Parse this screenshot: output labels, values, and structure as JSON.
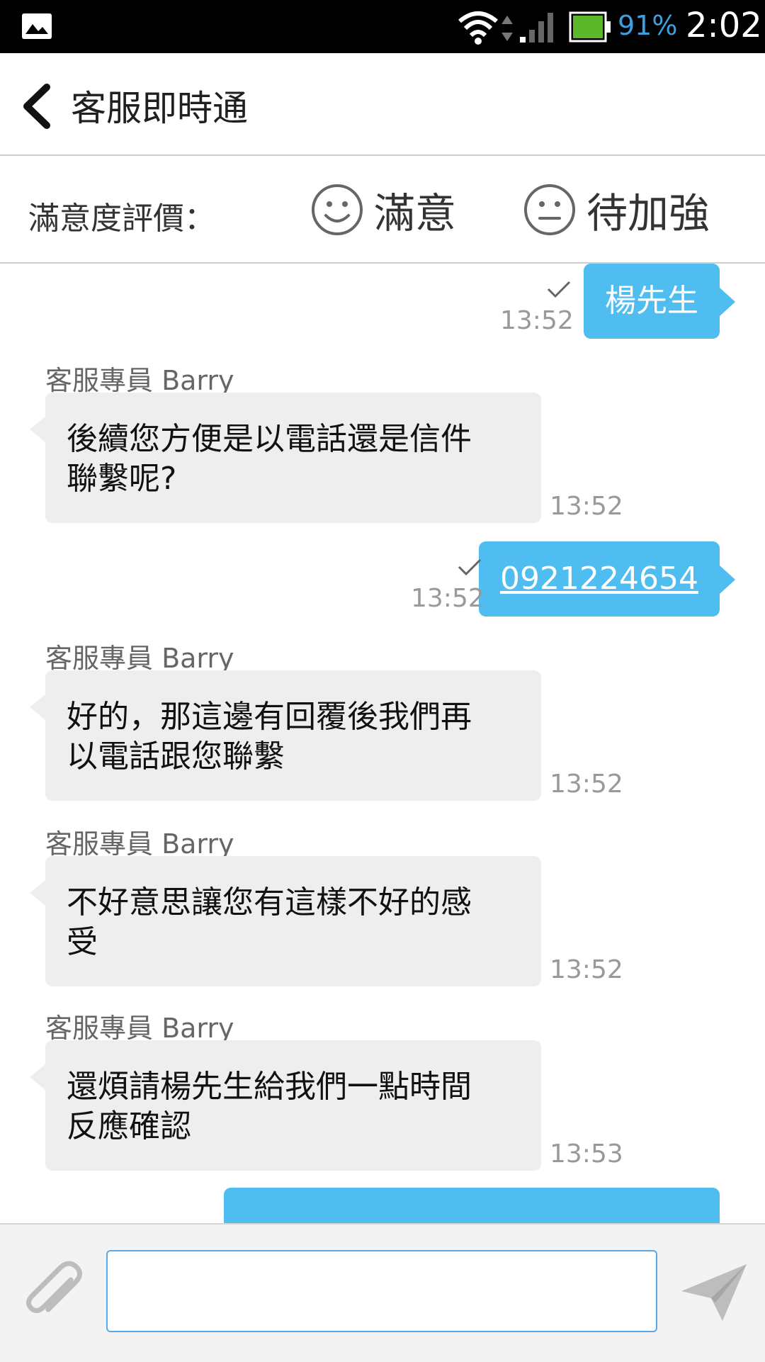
{
  "status_bar": {
    "battery_percent": "91%",
    "time": "2:02",
    "icons": [
      "gallery-icon",
      "wifi-icon",
      "data-arrows-icon",
      "signal-icon",
      "battery-icon"
    ]
  },
  "header": {
    "title": "客服即時通",
    "back_icon": "chevron-left-icon"
  },
  "rating": {
    "label": "滿意度評價：",
    "good_label": "滿意",
    "improve_label": "待加強"
  },
  "messages": [
    {
      "direction": "out",
      "text": "楊先生",
      "time": "13:52",
      "read": true
    },
    {
      "direction": "in",
      "sender": "客服專員 Barry",
      "line1": "後續您方便是以電話還是信件",
      "line2": "聯繫呢?",
      "time": "13:52"
    },
    {
      "direction": "out",
      "text": "0921224654",
      "time": "13:52",
      "read": true,
      "is_link": true
    },
    {
      "direction": "in",
      "sender": "客服專員 Barry",
      "line1": "好的，那這邊有回覆後我們再",
      "line2": "以電話跟您聯繫",
      "time": "13:52"
    },
    {
      "direction": "in",
      "sender": "客服專員 Barry",
      "line1": "不好意思讓您有這樣不好的感",
      "line2": "受",
      "time": "13:52"
    },
    {
      "direction": "in",
      "sender": "客服專員 Barry",
      "line1": "還煩請楊先生給我們一點時間",
      "line2": "反應確認",
      "time": "13:53"
    }
  ],
  "composer": {
    "input_value": "",
    "attach_icon": "paperclip-icon",
    "send_icon": "send-icon"
  },
  "colors": {
    "accent_blue": "#4fbdef",
    "incoming_bubble": "#eeeeee",
    "battery_green": "#5cb82a"
  }
}
